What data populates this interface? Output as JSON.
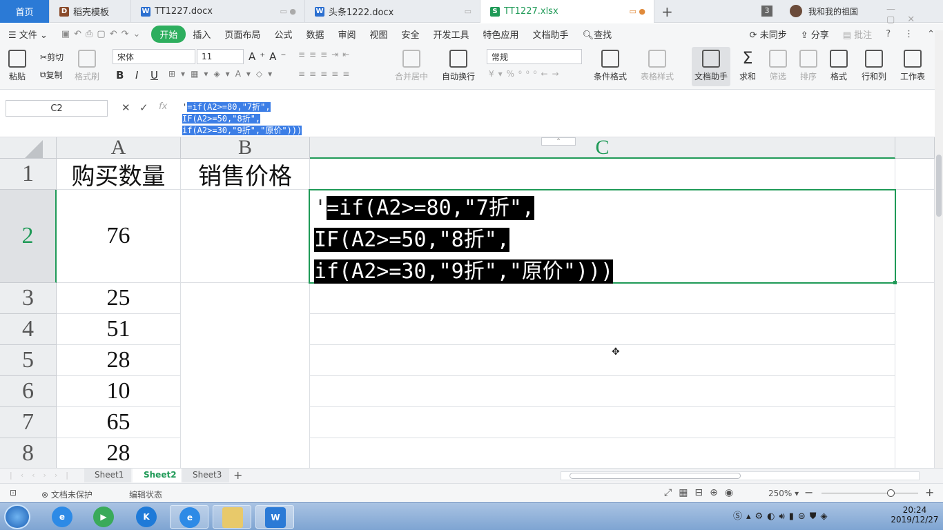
{
  "tabs": {
    "home": "首页",
    "t1": "稻壳模板",
    "t2": "TT1227.docx",
    "t3": "头条1222.docx",
    "t4": "TT1227.xlsx",
    "new_tab": "+",
    "count": "3",
    "user": "我和我的祖国"
  },
  "menu": {
    "file": "文件",
    "items": [
      "开始",
      "插入",
      "页面布局",
      "公式",
      "数据",
      "审阅",
      "视图",
      "安全",
      "开发工具",
      "特色应用",
      "文档助手"
    ],
    "search": "查找",
    "sync": "未同步",
    "share": "分享",
    "comment": "批注"
  },
  "ribbon": {
    "paste": "粘贴",
    "cut": "剪切",
    "copy": "复制",
    "format_painter": "格式刷",
    "font_name": "宋体",
    "font_size": "11",
    "bold": "B",
    "italic": "I",
    "underline": "U",
    "merge": "合并居中",
    "wrap": "自动换行",
    "number_format": "常规",
    "cond_format": "条件格式",
    "table_style": "表格样式",
    "doc_helper": "文档助手",
    "sum": "求和",
    "filter": "筛选",
    "sort": "排序",
    "format": "格式",
    "row_col": "行和列",
    "worksheet": "工作表"
  },
  "formula_bar": {
    "name_box": "C2",
    "fx": "fx",
    "line1_prefix": "'",
    "line1": "=if(A2>=80,\"7折\",",
    "line2": "IF(A2>=50,\"8折\",",
    "line3": "if(A2>=30,\"9折\",\"原价\")))"
  },
  "grid": {
    "columns": [
      "A",
      "B",
      "C"
    ],
    "rows": [
      "1",
      "2",
      "3",
      "4",
      "5",
      "6",
      "7",
      "8"
    ],
    "header_a": "购买数量",
    "header_b": "销售价格",
    "values_a": [
      "76",
      "25",
      "51",
      "28",
      "10",
      "65",
      "28"
    ],
    "c2_prefix": "'",
    "c2_line1": "=if(A2>=80,\"7折\",",
    "c2_line2": "IF(A2>=50,\"8折\",",
    "c2_line3": "if(A2>=30,\"9折\",\"原价\")))"
  },
  "sheets": [
    "Sheet1",
    "Sheet2",
    "Sheet3"
  ],
  "status": {
    "unprotected": "文档未保护",
    "edit_mode": "编辑状态",
    "zoom": "250%"
  },
  "taskbar": {
    "time": "20:24",
    "date": "2019/12/27"
  },
  "colors": {
    "accent_green": "#2dae5e",
    "home_tab_blue": "#2b7ad6",
    "selection_blue": "#3c7ee6"
  }
}
